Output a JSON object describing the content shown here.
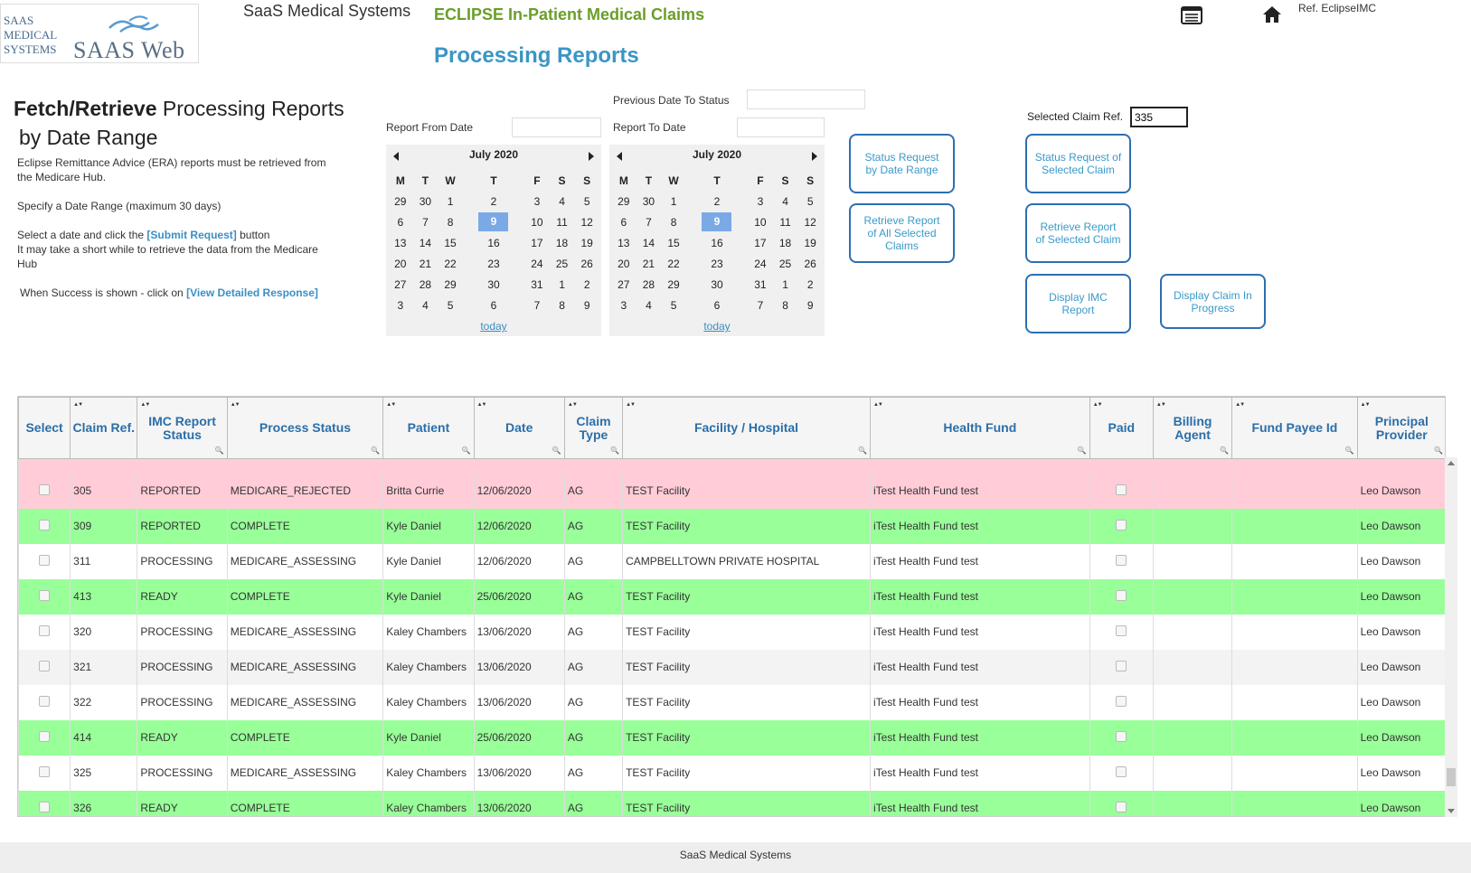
{
  "header": {
    "logo_left": "SAAS\nMEDICAL\nSYSTEMS",
    "logo_right": "SAAS Web",
    "company": "SaaS Medical Systems",
    "app_title": "ECLIPSE In-Patient Medical Claims",
    "page_title": "Processing Reports",
    "ref": "Ref. EclipseIMC"
  },
  "left": {
    "title_bold": "Fetch/Retrieve",
    "title_rest": " Processing Reports",
    "title_line2": "by Date Range",
    "para1": "Eclipse Remittance Advice (ERA) reports must be retrieved from the Medicare Hub.",
    "para2": "Specify a Date Range (maximum 30 days)",
    "para3_a": "Select a date and click the ",
    "para3_link": "[Submit Request]",
    "para3_b": " button",
    "para3_c": "It may take a short while to retrieve the data from the Medicare Hub",
    "para4_a": "When Success is shown - click on ",
    "para4_link": "[View Detailed Response]"
  },
  "dates": {
    "prev_label": "Previous Date To Status",
    "from_label": "Report From Date",
    "to_label": "Report To Date",
    "prev_value": "",
    "from_value": "",
    "to_value": ""
  },
  "calendar": {
    "month": "July 2020",
    "days": [
      "M",
      "T",
      "W",
      "T",
      "F",
      "S",
      "S"
    ],
    "weeks": [
      [
        "29",
        "30",
        "1",
        "2",
        "3",
        "4",
        "5"
      ],
      [
        "6",
        "7",
        "8",
        "9",
        "10",
        "11",
        "12"
      ],
      [
        "13",
        "14",
        "15",
        "16",
        "17",
        "18",
        "19"
      ],
      [
        "20",
        "21",
        "22",
        "23",
        "24",
        "25",
        "26"
      ],
      [
        "27",
        "28",
        "29",
        "30",
        "31",
        "1",
        "2"
      ],
      [
        "3",
        "4",
        "5",
        "6",
        "7",
        "8",
        "9"
      ]
    ],
    "selected": "9",
    "today": "today"
  },
  "buttons": {
    "status_date_range": "Status Request by Date Range",
    "retrieve_all": "Retrieve Report of All Selected Claims",
    "status_selected": "Status Request of Selected Claim",
    "retrieve_selected": "Retrieve Report of Selected Claim",
    "display_imc": "Display IMC Report",
    "display_progress": "Display Claim In Progress"
  },
  "selected_ref": {
    "label": "Selected Claim Ref.",
    "value": "335"
  },
  "table": {
    "columns": [
      "Select",
      "Claim Ref.",
      "IMC Report Status",
      "Process Status",
      "Patient",
      "Date",
      "Claim Type",
      "Facility / Hospital",
      "Health Fund",
      "Paid",
      "Billing Agent",
      "Fund Payee Id",
      "Principal Provider"
    ],
    "rows": [
      {
        "style": "pink",
        "ref": "305",
        "imc": "REPORTED",
        "process": "MEDICARE_REJECTED",
        "patient": "Britta Currie",
        "date": "12/06/2020",
        "type": "AG",
        "facility": "TEST Facility",
        "fund": "iTest Health Fund test",
        "agent": "",
        "payee": "",
        "provider": "Leo Dawson"
      },
      {
        "style": "green",
        "ref": "309",
        "imc": "REPORTED",
        "process": "COMPLETE",
        "patient": "Kyle Daniel",
        "date": "12/06/2020",
        "type": "AG",
        "facility": "TEST Facility",
        "fund": "iTest Health Fund test",
        "agent": "",
        "payee": "",
        "provider": "Leo Dawson"
      },
      {
        "style": "white",
        "ref": "311",
        "imc": "PROCESSING",
        "process": "MEDICARE_ASSESSING",
        "patient": "Kyle Daniel",
        "date": "12/06/2020",
        "type": "AG",
        "facility": "CAMPBELLTOWN PRIVATE HOSPITAL",
        "fund": "iTest Health Fund test",
        "agent": "",
        "payee": "",
        "provider": "Leo Dawson"
      },
      {
        "style": "green",
        "ref": "413",
        "imc": "READY",
        "process": "COMPLETE",
        "patient": "Kyle Daniel",
        "date": "25/06/2020",
        "type": "AG",
        "facility": "TEST Facility",
        "fund": "iTest Health Fund test",
        "agent": "",
        "payee": "",
        "provider": "Leo Dawson"
      },
      {
        "style": "white",
        "ref": "320",
        "imc": "PROCESSING",
        "process": "MEDICARE_ASSESSING",
        "patient": "Kaley Chambers",
        "date": "13/06/2020",
        "type": "AG",
        "facility": "TEST Facility",
        "fund": "iTest Health Fund test",
        "agent": "",
        "payee": "",
        "provider": "Leo Dawson"
      },
      {
        "style": "grey",
        "ref": "321",
        "imc": "PROCESSING",
        "process": "MEDICARE_ASSESSING",
        "patient": "Kaley Chambers",
        "date": "13/06/2020",
        "type": "AG",
        "facility": "TEST Facility",
        "fund": "iTest Health Fund test",
        "agent": "",
        "payee": "",
        "provider": "Leo Dawson"
      },
      {
        "style": "white",
        "ref": "322",
        "imc": "PROCESSING",
        "process": "MEDICARE_ASSESSING",
        "patient": "Kaley Chambers",
        "date": "13/06/2020",
        "type": "AG",
        "facility": "TEST Facility",
        "fund": "iTest Health Fund test",
        "agent": "",
        "payee": "",
        "provider": "Leo Dawson"
      },
      {
        "style": "green",
        "ref": "414",
        "imc": "READY",
        "process": "COMPLETE",
        "patient": "Kyle Daniel",
        "date": "25/06/2020",
        "type": "AG",
        "facility": "TEST Facility",
        "fund": "iTest Health Fund test",
        "agent": "",
        "payee": "",
        "provider": "Leo Dawson"
      },
      {
        "style": "white",
        "ref": "325",
        "imc": "PROCESSING",
        "process": "MEDICARE_ASSESSING",
        "patient": "Kaley Chambers",
        "date": "13/06/2020",
        "type": "AG",
        "facility": "TEST Facility",
        "fund": "iTest Health Fund test",
        "agent": "",
        "payee": "",
        "provider": "Leo Dawson"
      },
      {
        "style": "green",
        "ref": "326",
        "imc": "READY",
        "process": "COMPLETE",
        "patient": "Kaley Chambers",
        "date": "13/06/2020",
        "type": "AG",
        "facility": "TEST Facility",
        "fund": "iTest Health Fund test",
        "agent": "",
        "payee": "",
        "provider": "Leo Dawson"
      }
    ]
  },
  "footer": "SaaS Medical Systems",
  "colors": {
    "green_row": "#99ff99",
    "pink_row": "#ffccd8",
    "accent_blue": "#3a96c4",
    "title_green": "#6a9e2a"
  },
  "icons": {
    "menu": "list-icon",
    "home": "home-icon"
  }
}
